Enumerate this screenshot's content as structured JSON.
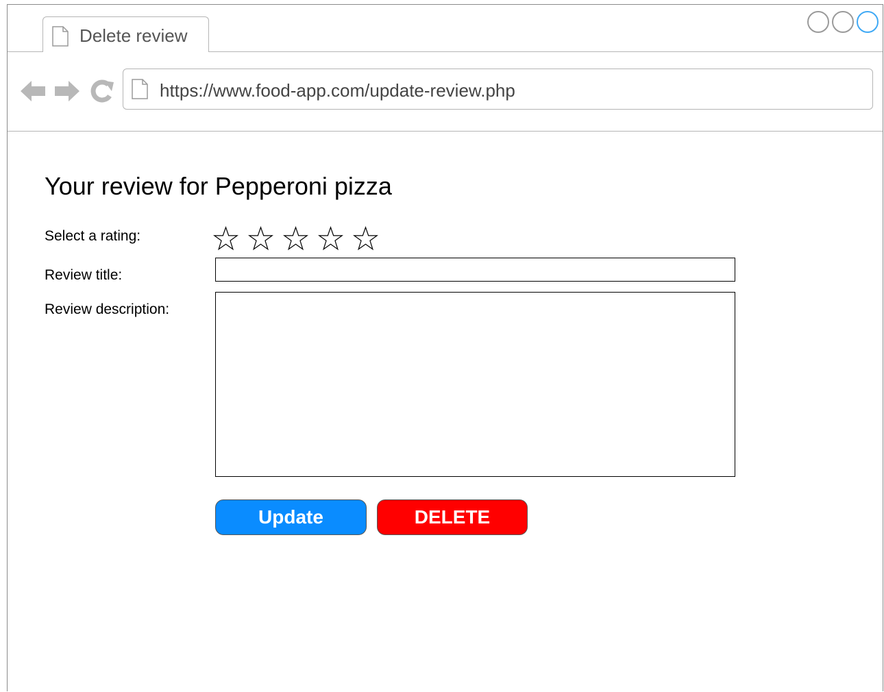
{
  "browser": {
    "tab_title": "Delete review",
    "address": "https://www.food-app.com/update-review.php",
    "nav_icons": [
      "back-arrow-icon",
      "forward-arrow-icon",
      "reload-icon"
    ],
    "accent_color": "#3fa9f5"
  },
  "page": {
    "title": "Your review for Pepperoni pizza",
    "rating_label": "Select a rating:",
    "rating": {
      "value": 0,
      "max": 5,
      "icon": "star-outline-icon"
    },
    "review_title_label": "Review title:",
    "review_title_value": "",
    "review_description_label": "Review description:",
    "review_description_value": ""
  },
  "buttons": {
    "update_label": "Update",
    "update_color": "#0a8cff",
    "delete_label": "DELETE",
    "delete_color": "#ff0000"
  }
}
